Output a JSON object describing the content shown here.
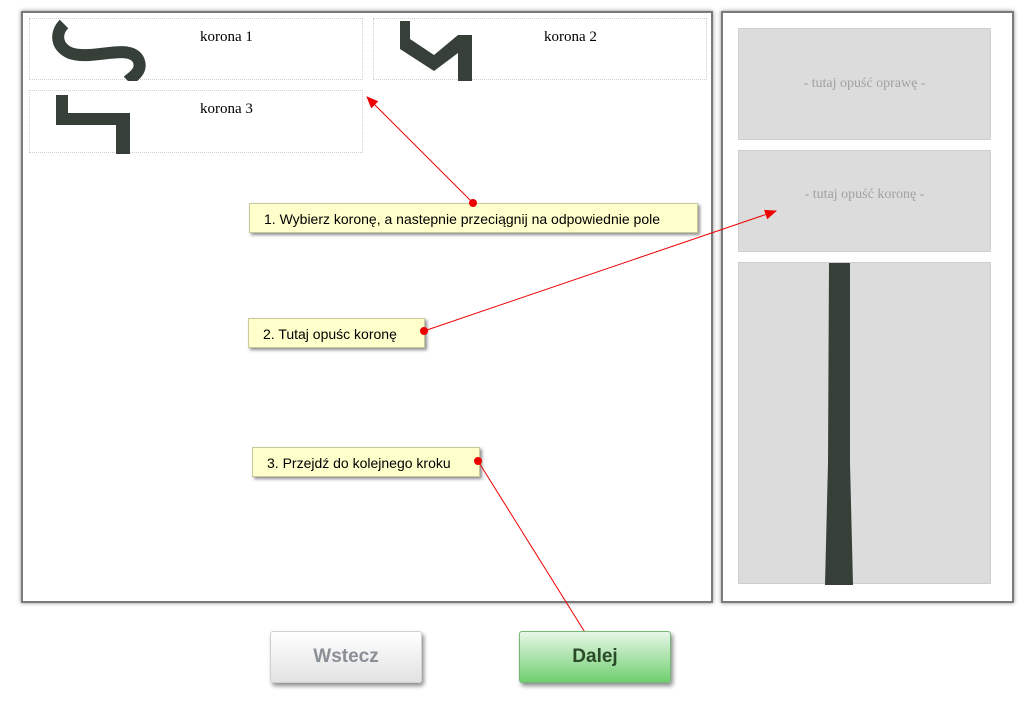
{
  "crowns": [
    {
      "label": "korona 1",
      "icon": "crown-1-profile-icon"
    },
    {
      "label": "korona 2",
      "icon": "crown-2-profile-icon"
    },
    {
      "label": "korona 3",
      "icon": "crown-3-profile-icon"
    }
  ],
  "dropzones": {
    "frame_placeholder": "- tutaj opuść oprawę -",
    "crown_placeholder": "- tutaj opuść koronę -"
  },
  "tips": [
    "1. Wybierz koronę, a nastepnie przeciągnij na odpowiednie pole",
    "2. Tutaj opuśc koronę",
    "3. Przejdź do kolejnego kroku"
  ],
  "buttons": {
    "back": "Wstecz",
    "next": "Dalej"
  },
  "colors": {
    "profile": "#363f38",
    "dropzone_bg": "#dcdcdc",
    "tip_bg": "#ffffcc",
    "arrow": "#ee0000",
    "next_button": "#6fcf6f"
  }
}
